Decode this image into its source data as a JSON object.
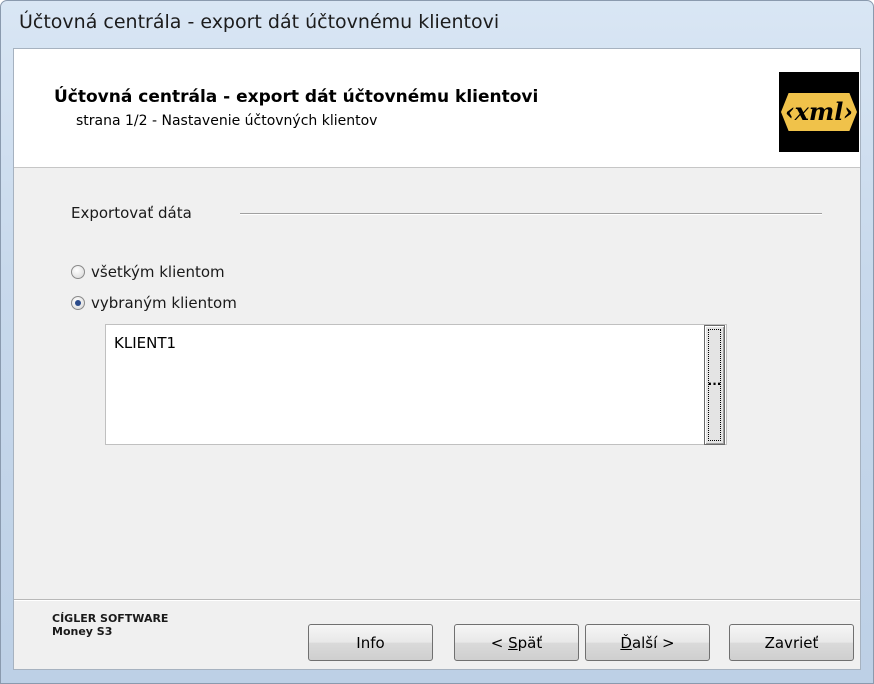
{
  "window": {
    "title": "Účtovná centrála - export dát účtovnému klientovi"
  },
  "header": {
    "title": "Účtovná centrála - export dát účtovnému klientovi",
    "subtitle": "strana 1/2 - Nastavenie účtovných klientov",
    "logo_text": "‹xml›"
  },
  "export_group": {
    "label": "Exportovať dáta",
    "options": [
      {
        "label": "všetkým klientom",
        "checked": false
      },
      {
        "label": "vybraným klientom",
        "checked": true
      }
    ],
    "selected_clients": [
      "KLIENT1"
    ],
    "browse_label": "..."
  },
  "footer": {
    "brand_line1": "CÍGLER SOFTWARE",
    "brand_line2": "Money S3"
  },
  "buttons": {
    "info": "Info",
    "back_prefix": "< ",
    "back_underline": "S",
    "back_rest": "päť",
    "next_underline": "Ď",
    "next_rest": "alší >",
    "close": "Zavrieť"
  },
  "colors": {
    "title_bar": "#c8d9ec",
    "panel_bg": "#f0f0f0",
    "logo_bg": "#000000",
    "logo_accent": "#f0c24a"
  }
}
